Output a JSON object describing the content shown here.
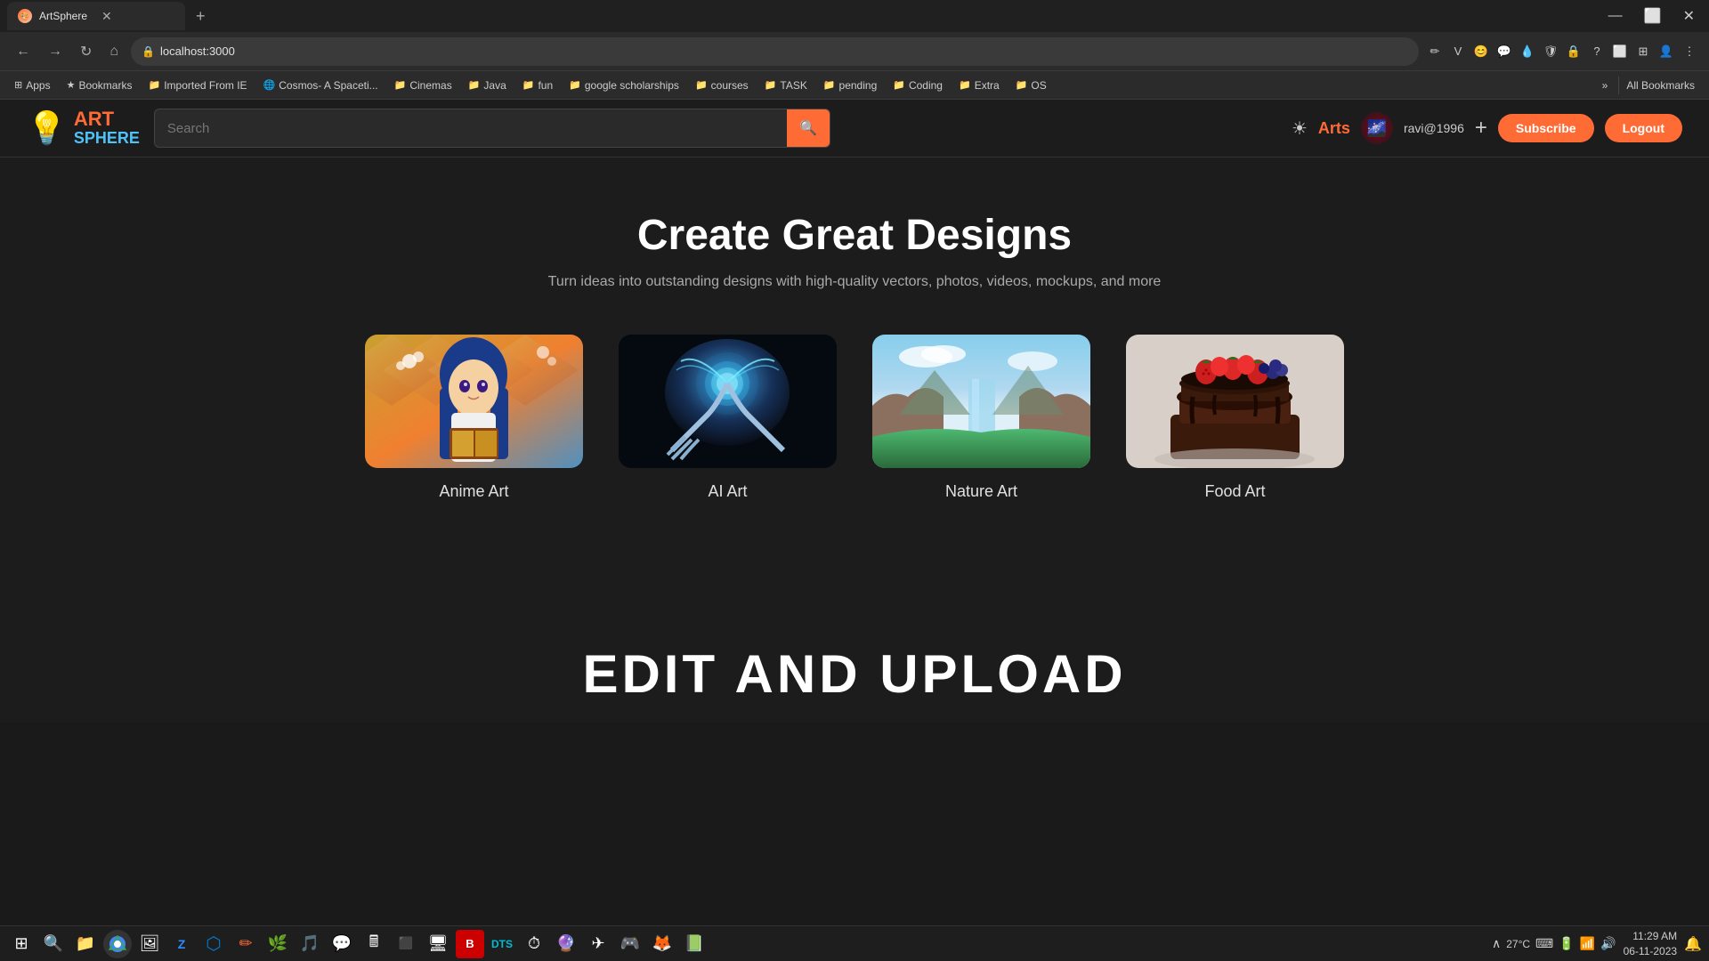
{
  "browser": {
    "tab_title": "ArtSphere",
    "tab_favicon": "🎨",
    "new_tab_label": "+",
    "url": "localhost:3000",
    "win_minimize": "—",
    "win_maximize": "⬜",
    "win_close": "✕"
  },
  "nav": {
    "back": "←",
    "forward": "→",
    "refresh": "↻",
    "home": "⌂",
    "lock_icon": "🔒"
  },
  "bookmarks": {
    "bar": [
      {
        "label": "Apps",
        "icon": "⊞",
        "type": "apps"
      },
      {
        "label": "Bookmarks",
        "icon": "★"
      },
      {
        "label": "Imported From IE",
        "icon": "📁"
      },
      {
        "label": "Cosmos- A Spaceti...",
        "icon": "🌐"
      },
      {
        "label": "Cinemas",
        "icon": "📁"
      },
      {
        "label": "Java",
        "icon": "📁"
      },
      {
        "label": "fun",
        "icon": "📁"
      },
      {
        "label": "google scholarships",
        "icon": "📁"
      },
      {
        "label": "courses",
        "icon": "📁"
      },
      {
        "label": "TASK",
        "icon": "📁"
      },
      {
        "label": "pending",
        "icon": "📁"
      },
      {
        "label": "Coding",
        "icon": "📁"
      },
      {
        "label": "Extra",
        "icon": "📁"
      },
      {
        "label": "OS",
        "icon": "📁"
      }
    ],
    "more": "»",
    "all_bookmarks": "All Bookmarks"
  },
  "site": {
    "logo_art": "ART",
    "logo_sphere": "SPHERE",
    "logo_icon": "💡",
    "search_placeholder": "Search",
    "search_btn_icon": "🔍",
    "nav_arts": "Arts",
    "username": "ravi@1996",
    "add_btn": "+",
    "subscribe_btn": "Subscribe",
    "logout_btn": "Logout"
  },
  "hero": {
    "title": "Create Great Designs",
    "subtitle": "Turn ideas into outstanding designs with high-quality vectors, photos, videos, mockups, and more"
  },
  "art_cards": [
    {
      "label": "Anime Art",
      "type": "anime"
    },
    {
      "label": "AI Art",
      "type": "ai"
    },
    {
      "label": "Nature Art",
      "type": "nature"
    },
    {
      "label": "Food Art",
      "type": "food"
    }
  ],
  "edit_section": {
    "title": "EDIT AND UPLOAD"
  },
  "taskbar": {
    "icons": [
      {
        "name": "windows-start",
        "symbol": "⊞"
      },
      {
        "name": "search",
        "symbol": "🔍"
      },
      {
        "name": "file-explorer",
        "symbol": "📁"
      },
      {
        "name": "chrome",
        "symbol": "🌐"
      },
      {
        "name": "photos",
        "symbol": "🖼"
      },
      {
        "name": "zoom",
        "symbol": "Z"
      },
      {
        "name": "vscode",
        "symbol": "⬡"
      },
      {
        "name": "pencil",
        "symbol": "✏"
      },
      {
        "name": "app6",
        "symbol": "🌿"
      },
      {
        "name": "app7",
        "symbol": "🎵"
      },
      {
        "name": "whatsapp",
        "symbol": "📱"
      },
      {
        "name": "calculator",
        "symbol": "🖩"
      },
      {
        "name": "terminal",
        "symbol": ">_"
      },
      {
        "name": "app10",
        "symbol": "🖥"
      },
      {
        "name": "bravo",
        "symbol": "B"
      },
      {
        "name": "dts",
        "symbol": "D"
      },
      {
        "name": "clock2",
        "symbol": "⏱"
      },
      {
        "name": "app14",
        "symbol": "🔮"
      },
      {
        "name": "telegram",
        "symbol": "✈"
      },
      {
        "name": "discord",
        "symbol": "🎮"
      },
      {
        "name": "firefox",
        "symbol": "🦊"
      },
      {
        "name": "app18",
        "symbol": "📗"
      }
    ],
    "weather": "27°C",
    "time": "11:29 AM",
    "date": "06-11-2023"
  }
}
